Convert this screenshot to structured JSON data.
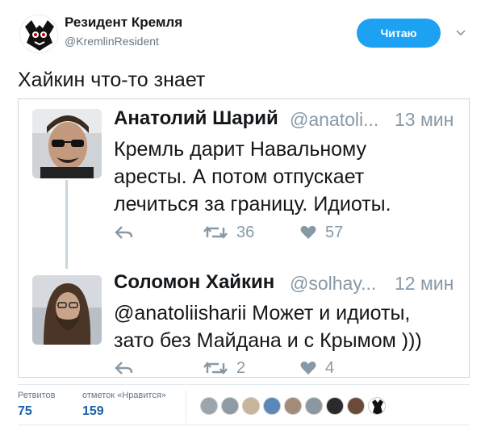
{
  "author": {
    "name": "Резидент Кремля",
    "handle": "@KremlinResident",
    "follow_label": "Читаю"
  },
  "tweet": {
    "text": "Хайкин что-то знает"
  },
  "quoted_tweets": [
    {
      "name": "Анатолий Шарий",
      "handle": "@anatoli...",
      "time": "13 мин",
      "lines": [
        "Кремль дарит Навальному",
        "аресты. А потом отпускает",
        "лечиться за границу. Идиоты."
      ],
      "retweets": "36",
      "likes": "57"
    },
    {
      "name": "Соломон Хайкин",
      "handle": "@solhay...",
      "time": "12 мин",
      "lines": [
        "@anatoliisharii Может и идиоты,",
        "зато без Майдана и с Крымом )))"
      ],
      "retweets": "2",
      "likes": "4"
    }
  ],
  "stats": {
    "retweets_label": "Ретвитов",
    "retweets_value": "75",
    "likes_label": "отметок «Нравится»",
    "likes_value": "159"
  },
  "colors": {
    "accent": "#1da1f2",
    "stat_value": "#1b5fa8",
    "muted": "#8899a6"
  }
}
